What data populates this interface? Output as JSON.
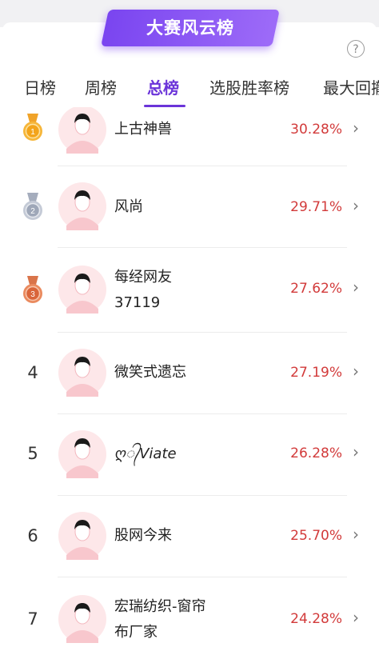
{
  "header": {
    "title": "大赛风云榜",
    "help_label": "?"
  },
  "tabs": [
    {
      "label": "日榜",
      "active": false
    },
    {
      "label": "周榜",
      "active": false
    },
    {
      "label": "总榜",
      "active": true
    },
    {
      "label": "选股胜率榜",
      "active": false
    },
    {
      "label": "最大回撤",
      "active": false
    }
  ],
  "rankings": [
    {
      "rank": "1",
      "medal": "gold",
      "name_line1": "上古神兽",
      "name_line2": "",
      "return_pct": "30.28%"
    },
    {
      "rank": "2",
      "medal": "silver",
      "name_line1": "风尚",
      "name_line2": "",
      "return_pct": "29.71%"
    },
    {
      "rank": "3",
      "medal": "bronze",
      "name_line1": "每经网友",
      "name_line2": "37119",
      "return_pct": "27.62%"
    },
    {
      "rank": "4",
      "medal": "",
      "name_line1": "微笑式遗忘",
      "name_line2": "",
      "return_pct": "27.19%"
    },
    {
      "rank": "5",
      "medal": "",
      "name_line1": "ღ᭄Viate",
      "name_line2": "",
      "return_pct": "26.28%"
    },
    {
      "rank": "6",
      "medal": "",
      "name_line1": "股网今来",
      "name_line2": "",
      "return_pct": "25.70%"
    },
    {
      "rank": "7",
      "medal": "",
      "name_line1": "宏瑞纺织-窗帘",
      "name_line2": "布厂家",
      "return_pct": "24.28%"
    }
  ],
  "colors": {
    "accent": "#6b34d9",
    "banner": "#8a55f5",
    "positive": "#d23a3a"
  }
}
